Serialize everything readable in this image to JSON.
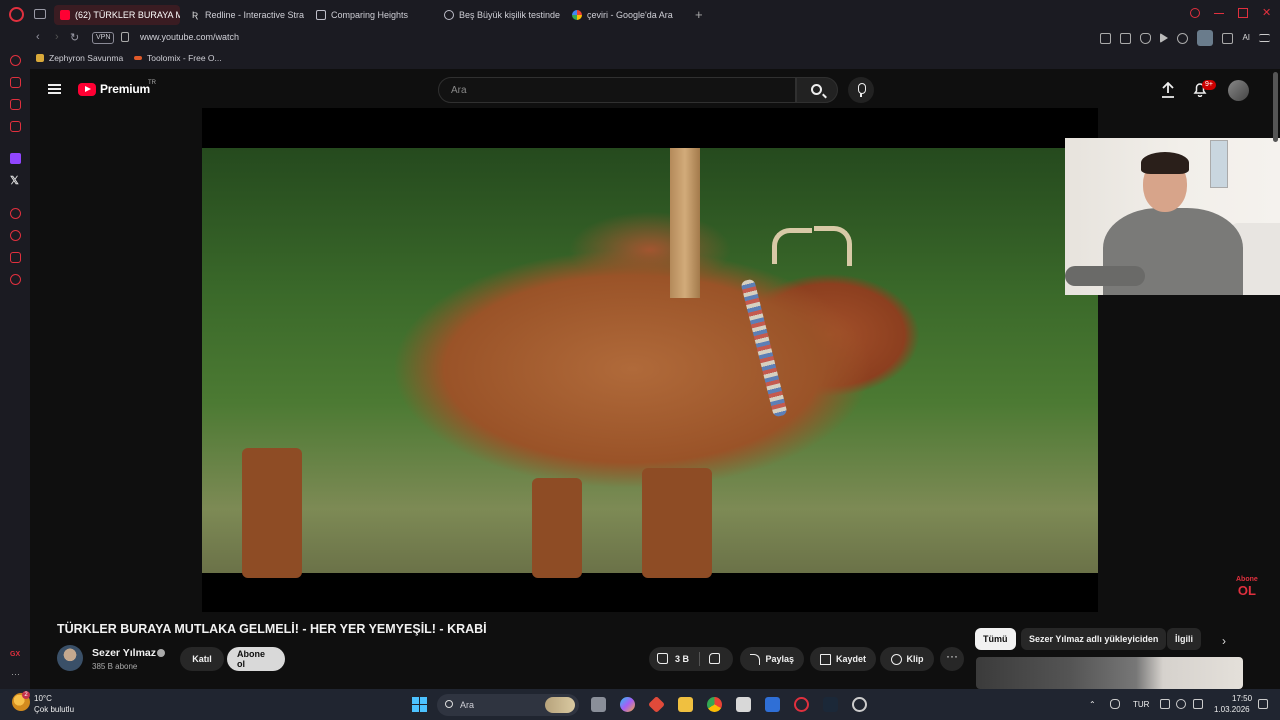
{
  "browser": {
    "tabs": [
      {
        "label": "(62) TÜRKLER BURAYA M",
        "active": true,
        "icon": "youtube-icon"
      },
      {
        "label": "Redline - Interactive Strat",
        "active": false,
        "icon": "redline-icon"
      },
      {
        "label": "Comparing Heights",
        "active": false,
        "icon": "document-icon"
      },
      {
        "label": "Beş Büyük kişilik testinde",
        "active": false,
        "icon": "globe-icon"
      },
      {
        "label": "çeviri - Google'da Ara",
        "active": false,
        "icon": "google-icon"
      }
    ],
    "vpn_label": "VPN",
    "url": "www.youtube.com/watch",
    "ai_label": "AI",
    "bookmarks": [
      {
        "label": "Zephyron Savunma",
        "icon": "shield-icon"
      },
      {
        "label": "Toolomix - Free O...",
        "icon": "toolomix-icon"
      }
    ],
    "accent_color": "#e0303e"
  },
  "youtube": {
    "brand": "Premium",
    "region": "TR",
    "search_placeholder": "Ara",
    "notification_count": "9+",
    "video": {
      "title": "TÜRKLER BURAYA MUTLAKA GELMELİ! - HER YER YEMYEŞİL! - KRABİ",
      "watermark_small": "Abone",
      "watermark_big": "OL"
    },
    "channel": {
      "name": "Sezer Yılmaz",
      "subscribers": "385 B abone",
      "join_label": "Katıl",
      "subscribe_label": "Abone ol"
    },
    "actions": {
      "likes": "3 B",
      "share": "Paylaş",
      "save": "Kaydet",
      "clip": "Klip"
    },
    "chips": [
      {
        "label": "Tümü",
        "selected": true
      },
      {
        "label": "Sezer Yılmaz adlı yükleyiciden",
        "selected": false
      },
      {
        "label": "İlgili",
        "selected": false
      }
    ]
  },
  "taskbar": {
    "weather_badge": "2",
    "temperature": "10°C",
    "weather": "Çok bulutlu",
    "search_label": "Ara",
    "language": "TUR",
    "time": "17:50",
    "date": "1.03.2026"
  }
}
